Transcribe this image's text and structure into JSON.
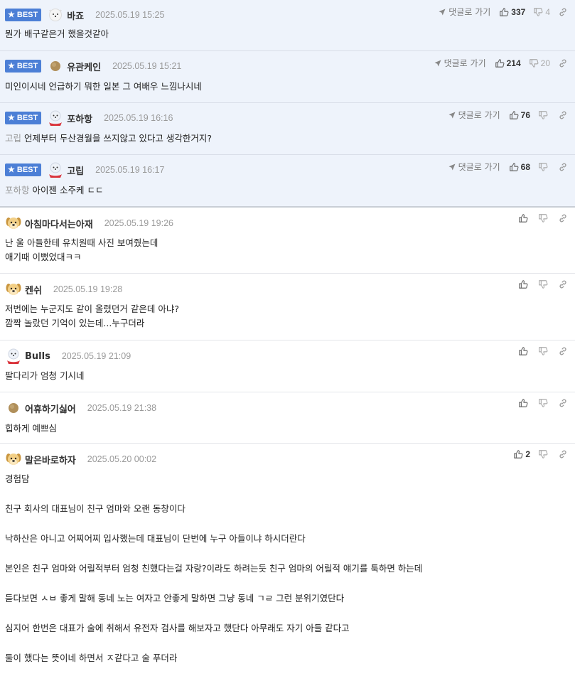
{
  "best_label": "BEST",
  "goto_label": "댓글로 가기",
  "icons": [
    "star-icon",
    "avatar-icon",
    "send-icon",
    "thumbs-up-icon",
    "thumbs-down-icon",
    "link-icon"
  ],
  "colors": {
    "best_bg": "#eef3fb",
    "badge": "#4c7fd6"
  },
  "comments": [
    {
      "nick": "바죠",
      "date": "2025.05.19 15:25",
      "likes": "337",
      "dislikes": "4",
      "text": "뭔가 배구같은거 했을것같아"
    },
    {
      "nick": "유관케인",
      "date": "2025.05.19 15:21",
      "likes": "214",
      "dislikes": "20",
      "text": "미인이시네 언급하기 뭐한 일본 그 여배우 느낌나시네"
    },
    {
      "nick": "포하항",
      "date": "2025.05.19 16:16",
      "likes": "76",
      "mention": "고립",
      "text": "언제부터 두산경월을 쓰지않고 있다고 생각한거지?"
    },
    {
      "nick": "고립",
      "date": "2025.05.19 16:17",
      "likes": "68",
      "mention": "포하항",
      "text": "아이젠 소주케 ㄷㄷ"
    },
    {
      "nick": "아침마다서는아재",
      "date": "2025.05.19 19:26",
      "line1": "난 울 아들한테 유치원때 사진 보여줬는데",
      "line2": "애기때 이뻤었대ㅋㅋ"
    },
    {
      "nick": "켄쉬",
      "date": "2025.05.19 19:28",
      "line1": "저번에는 누군지도 같이 올렸던거 같은데 아냐?",
      "line2": "깜짝 놀랐던 기억이 있는데...누구더라"
    },
    {
      "nick": "Bulls",
      "date": "2025.05.19 21:09",
      "text": "팔다리가 엄청 기시네"
    },
    {
      "nick": "어휴하기싫어",
      "date": "2025.05.19 21:38",
      "text": "힙하게 예쁘심"
    },
    {
      "nick": "말은바로하자",
      "date": "2025.05.20 00:02",
      "likes": "2",
      "paras": [
        "경험담",
        "친구 회사의 대표님이 친구 엄마와 오랜 동창이다",
        "낙하산은 아니고 어찌어찌 입사했는데 대표님이 단번에 누구 아들이냐 하시더란다",
        "본인은 친구 엄마와 어릴적부터 엄청 친했다는걸 자랑?이라도 하려는듯 친구 엄마의 어릴적 얘기를 툭하면 하는데",
        "듣다보면 ㅅㅂ 좋게 말해 동네 노는 여자고 안좋게 말하면 그냥 동네 ㄱㄹ 그런 분위기였단다",
        "심지어 한번은 대표가 술에 취해서 유전자 검사를 해보자고 했단다 아무래도 자기 아들 같다고",
        "둘이 했다는 뜻이네 하면서 ㅈ같다고 술 푸더라"
      ]
    }
  ]
}
